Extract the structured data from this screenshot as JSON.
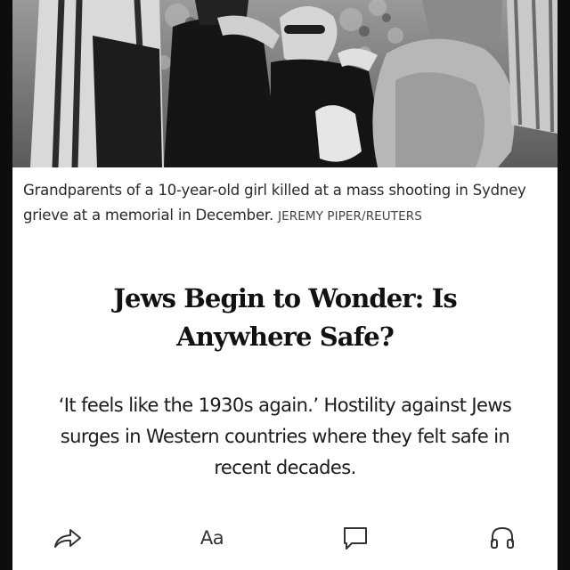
{
  "article": {
    "photo": {
      "alt_icon": "news-photo"
    },
    "caption": {
      "text": "Grandparents of a 10-year-old girl killed at a mass shooting in Sydney grieve at a memorial in December.",
      "credit": "JEREMY PIPER/REUTERS"
    },
    "headline": "Jews Begin to Wonder: Is Anywhere Safe?",
    "dek": "‘It feels like the 1930s again.’ Hostility against Jews surges in Western countries where they felt safe in recent decades."
  },
  "toolbar": {
    "share": {
      "icon": "share-arrow-icon"
    },
    "text_size": {
      "label": "Aa"
    },
    "comments": {
      "icon": "comment-bubble-icon"
    },
    "listen": {
      "icon": "headphones-icon"
    }
  }
}
